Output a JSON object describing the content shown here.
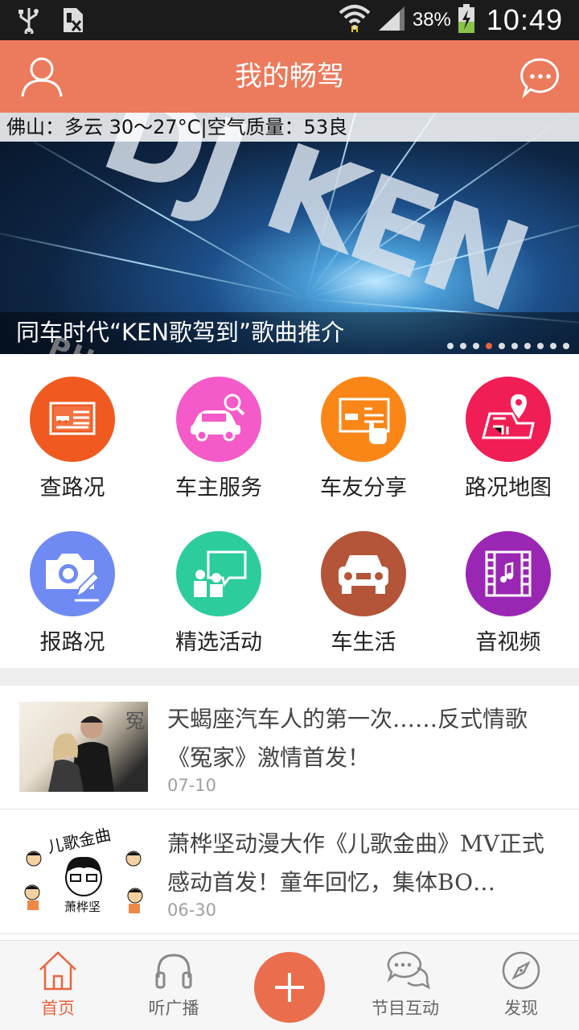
{
  "status_bar": {
    "battery_percent": "38%",
    "time": "10:49"
  },
  "header": {
    "title": "我的畅驾"
  },
  "banner": {
    "weather": "佛山：多云 30～27°C|空气质量：53良",
    "title_art": "DJ KEN",
    "subtitle_art": "PHOTOBOOK",
    "caption": "同车时代“KEN歌驾到”歌曲推介",
    "slide_count": 10,
    "active_slide": 4
  },
  "grid": {
    "items": [
      {
        "label": "查路况",
        "icon": "road-report-card-icon",
        "color": "#f05a20"
      },
      {
        "label": "车主服务",
        "icon": "car-search-icon",
        "color": "#f45ac8"
      },
      {
        "label": "车友分享",
        "icon": "touch-screen-icon",
        "color": "#fa8618"
      },
      {
        "label": "路况地图",
        "icon": "map-pin-icon",
        "color": "#f01e55"
      },
      {
        "label": "报路况",
        "icon": "camera-edit-icon",
        "color": "#6f8af2"
      },
      {
        "label": "精选活动",
        "icon": "people-board-icon",
        "color": "#2dcc9c"
      },
      {
        "label": "车生活",
        "icon": "car-front-icon",
        "color": "#b45438"
      },
      {
        "label": "音视频",
        "icon": "film-music-icon",
        "color": "#9a26b4"
      }
    ]
  },
  "news": [
    {
      "title": "天蝎座汽车人的第一次……反式情歌《冤家》激情首发！",
      "date": "07-10",
      "thumb_text": "冤"
    },
    {
      "title": "萧桦坚动漫大作《儿歌金曲》MV正式感动首发！童年回忆，集体BO…",
      "date": "06-30",
      "thumb_text": "儿歌金曲",
      "thumb_caption": "萧桦坚"
    }
  ],
  "bottom_nav": {
    "tabs": [
      {
        "label": "首页",
        "icon": "home-icon",
        "active": true
      },
      {
        "label": "听广播",
        "icon": "headphones-icon",
        "active": false
      },
      {
        "label": "",
        "icon": "plus-icon",
        "active": false
      },
      {
        "label": "节目互动",
        "icon": "chat-bubbles-icon",
        "active": false
      },
      {
        "label": "发现",
        "icon": "compass-icon",
        "active": false
      }
    ]
  },
  "colors": {
    "accent": "#ec7a5c",
    "active_tab": "#e8643f"
  }
}
